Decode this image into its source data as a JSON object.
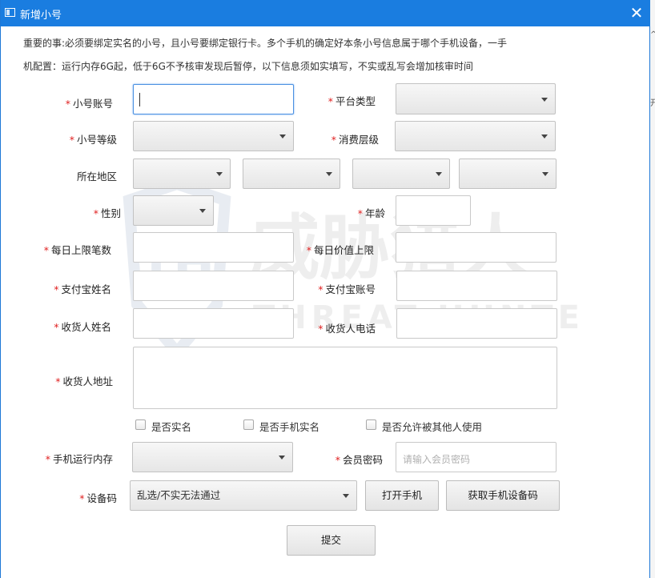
{
  "window": {
    "title": "新增小号",
    "close_glyph": "✕"
  },
  "notice": {
    "line1": "重要的事:必须要绑定实名的小号，且小号要绑定银行卡。多个手机的确定好本条小号信息属于哪个手机设备，一手",
    "line2": "机配置：运行内存6G起，低于6G不予核审发现后暂停，以下信息须如实填写，不实或乱写会增加核审时间"
  },
  "form": {
    "required_mark": "*",
    "account_label": "小号账号",
    "platform_label": "平台类型",
    "level_label": "小号等级",
    "consumption_label": "消费层级",
    "region_label": "所在地区",
    "gender_label": "性别",
    "age_label": "年龄",
    "daily_count_label": "每日上限笔数",
    "daily_value_label": "每日价值上限",
    "alipay_name_label": "支付宝姓名",
    "alipay_account_label": "支付宝账号",
    "recipient_name_label": "收货人姓名",
    "recipient_phone_label": "收货人电话",
    "recipient_address_label": "收货人地址",
    "checkbox_realname": "是否实名",
    "checkbox_phone_realname": "是否手机实名",
    "checkbox_allow_others": "是否允许被其他人使用",
    "memory_label": "手机运行内存",
    "member_pwd_label": "会员密码",
    "member_pwd_placeholder": "请输入会员密码",
    "device_code_label": "设备码",
    "device_code_value": "乱选/不实无法通过",
    "open_phone_button": "打开手机",
    "get_device_code_button": "获取手机设备码",
    "submit_button": "提交"
  },
  "watermark": {
    "cn": "威胁猎人",
    "en": "THREAT HUNTER",
    "logo": "TH"
  },
  "edge": {
    "glyph1": "^",
    "glyph2": "开"
  }
}
